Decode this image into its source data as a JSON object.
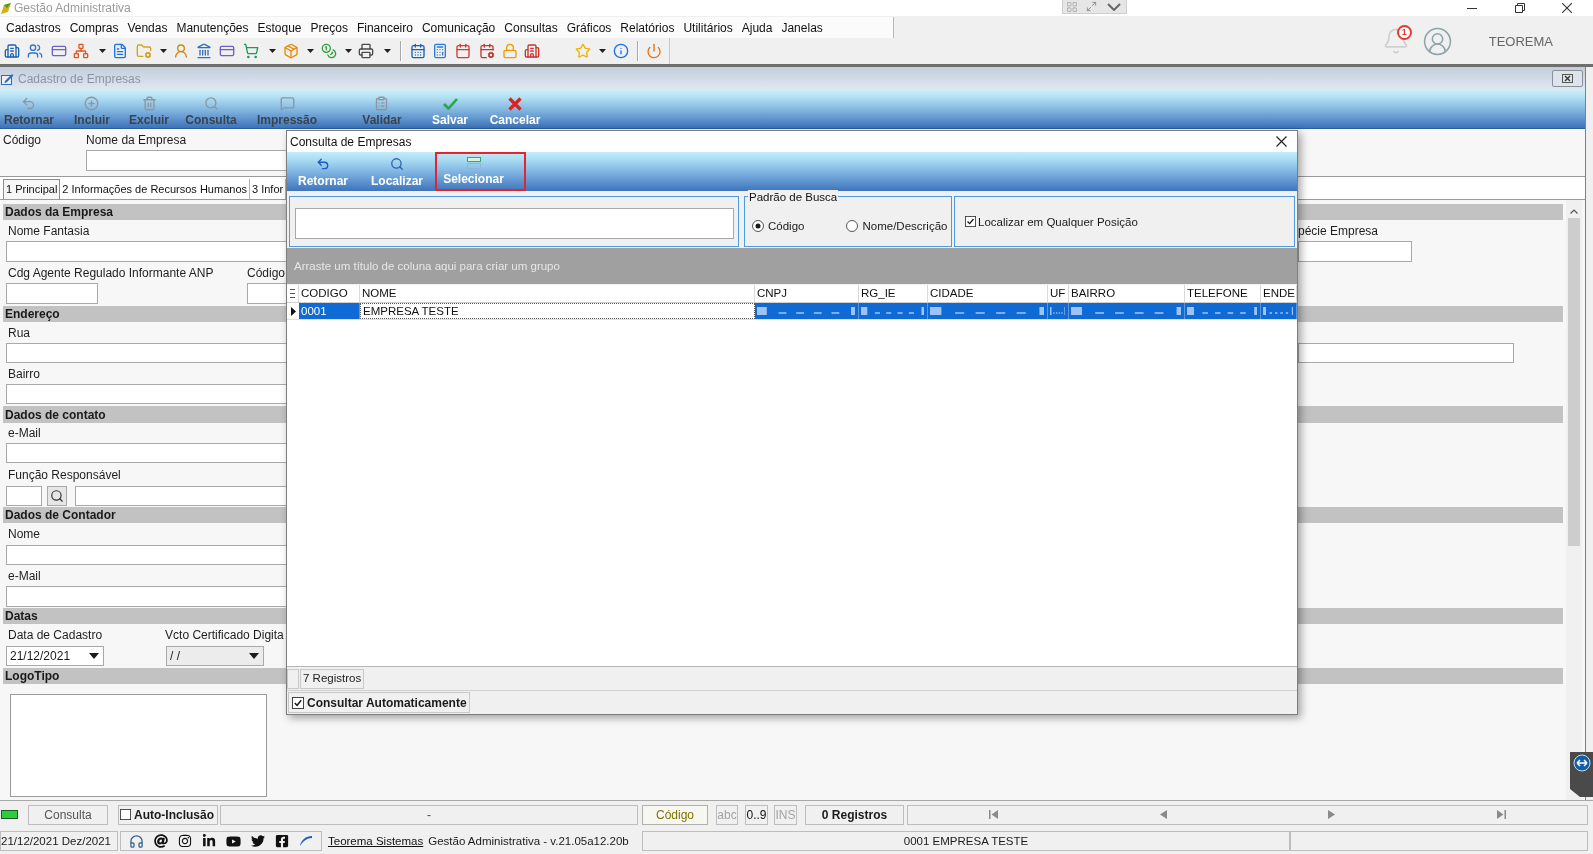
{
  "window": {
    "title": "Gestão Administrativa"
  },
  "menu": [
    "Cadastros",
    "Compras",
    "Vendas",
    "Manutenções",
    "Estoque",
    "Preços",
    "Financeiro",
    "Comunicação",
    "Consultas",
    "Gráficos",
    "Relatórios",
    "Utilitários",
    "Ajuda",
    "Janelas"
  ],
  "user": {
    "notifications": "1",
    "name": "TEOREMA"
  },
  "child_window": {
    "title": "Cadastro de Empresas",
    "toolbar": [
      {
        "label": "Retornar",
        "disabled": true
      },
      {
        "label": "Incluir",
        "disabled": true
      },
      {
        "label": "Excluir",
        "disabled": true
      },
      {
        "label": "Consulta",
        "disabled": true
      },
      {
        "label": "Impressão",
        "disabled": true
      },
      {
        "label": "Validar",
        "disabled": true
      },
      {
        "label": "Salvar",
        "disabled": false
      },
      {
        "label": "Cancelar",
        "disabled": false
      }
    ],
    "header_labels": [
      "Código",
      "Nome da Empresa"
    ],
    "tabs": [
      {
        "label": "1 Principal",
        "selected": true
      },
      {
        "label": "2 Informações de Recursos Humanos",
        "selected": false
      },
      {
        "label": "3 Infor",
        "selected": false
      }
    ],
    "sections": [
      {
        "title": "Dados da Empresa",
        "labels": [
          "Nome Fantasia",
          "pécie Empresa",
          "Cdg Agente Regulado Informante ANP",
          "Código"
        ]
      },
      {
        "title": "Endereço",
        "labels": [
          "Rua",
          "Bairro"
        ]
      },
      {
        "title": "Dados de contato",
        "labels": [
          "e-Mail",
          "Função Responsável"
        ]
      },
      {
        "title": "Dados de Contador",
        "labels": [
          "Nome",
          "e-Mail"
        ]
      },
      {
        "title": "Datas",
        "labels": [
          "Data de Cadastro",
          "Vcto Certificado Digita"
        ],
        "values": [
          "21/12/2021",
          "/ /"
        ]
      },
      {
        "title": "LogoTipo"
      }
    ]
  },
  "dialog": {
    "title": "Consulta de Empresas",
    "toolbar": [
      {
        "label": "Retornar",
        "highlighted": false
      },
      {
        "label": "Localizar",
        "highlighted": false
      },
      {
        "label": "Selecionar",
        "highlighted": true
      }
    ],
    "search_mode": {
      "title": "Padrão de Busca",
      "options": [
        {
          "label": "Código",
          "selected": true
        },
        {
          "label": "Nome/Descrição",
          "selected": false
        }
      ]
    },
    "match_anywhere": {
      "label": "Localizar em Qualquer Posição",
      "checked": true
    },
    "group_hint": "Arraste um título de coluna aqui para criar um grupo",
    "table": {
      "columns": [
        "CODIGO",
        "NOME",
        "CNPJ",
        "RG_IE",
        "CIDADE",
        "UF",
        "BAIRRO",
        "TELEFONE",
        "ENDE"
      ],
      "rows": [
        {
          "selected": true,
          "cells": [
            {
              "kind": "text",
              "text": "0001",
              "focused": false
            },
            {
              "kind": "text",
              "text": "EMPRESA TESTE",
              "focused": true
            },
            {
              "kind": "blurred",
              "focused": false
            },
            {
              "kind": "blurred",
              "focused": false
            },
            {
              "kind": "blurred",
              "focused": false
            },
            {
              "kind": "blurred",
              "focused": false
            },
            {
              "kind": "blurred",
              "focused": false
            },
            {
              "kind": "blurred",
              "focused": false
            },
            {
              "kind": "blurred",
              "focused": false
            }
          ]
        }
      ]
    },
    "record_count": "7 Registros",
    "auto_query": {
      "label": "Consultar Automaticamente",
      "checked": true
    }
  },
  "status_bar": {
    "mode": "Consulta",
    "auto_insert": {
      "label": "Auto-Inclusão",
      "checked": false
    },
    "info": "-",
    "search_field": "Código",
    "input_modes": [
      {
        "label": "abc",
        "active": false
      },
      {
        "label": "0..9",
        "active": true
      },
      {
        "label": "INS",
        "active": false
      }
    ],
    "records": "0 Registros"
  },
  "footer": {
    "date": "21/12/2021 Dez/2021",
    "link": "Teorema Sistemas",
    "version": "Gestão Administrativa - v.21.05a12.20b",
    "company": "0001 EMPRESA TESTE"
  }
}
